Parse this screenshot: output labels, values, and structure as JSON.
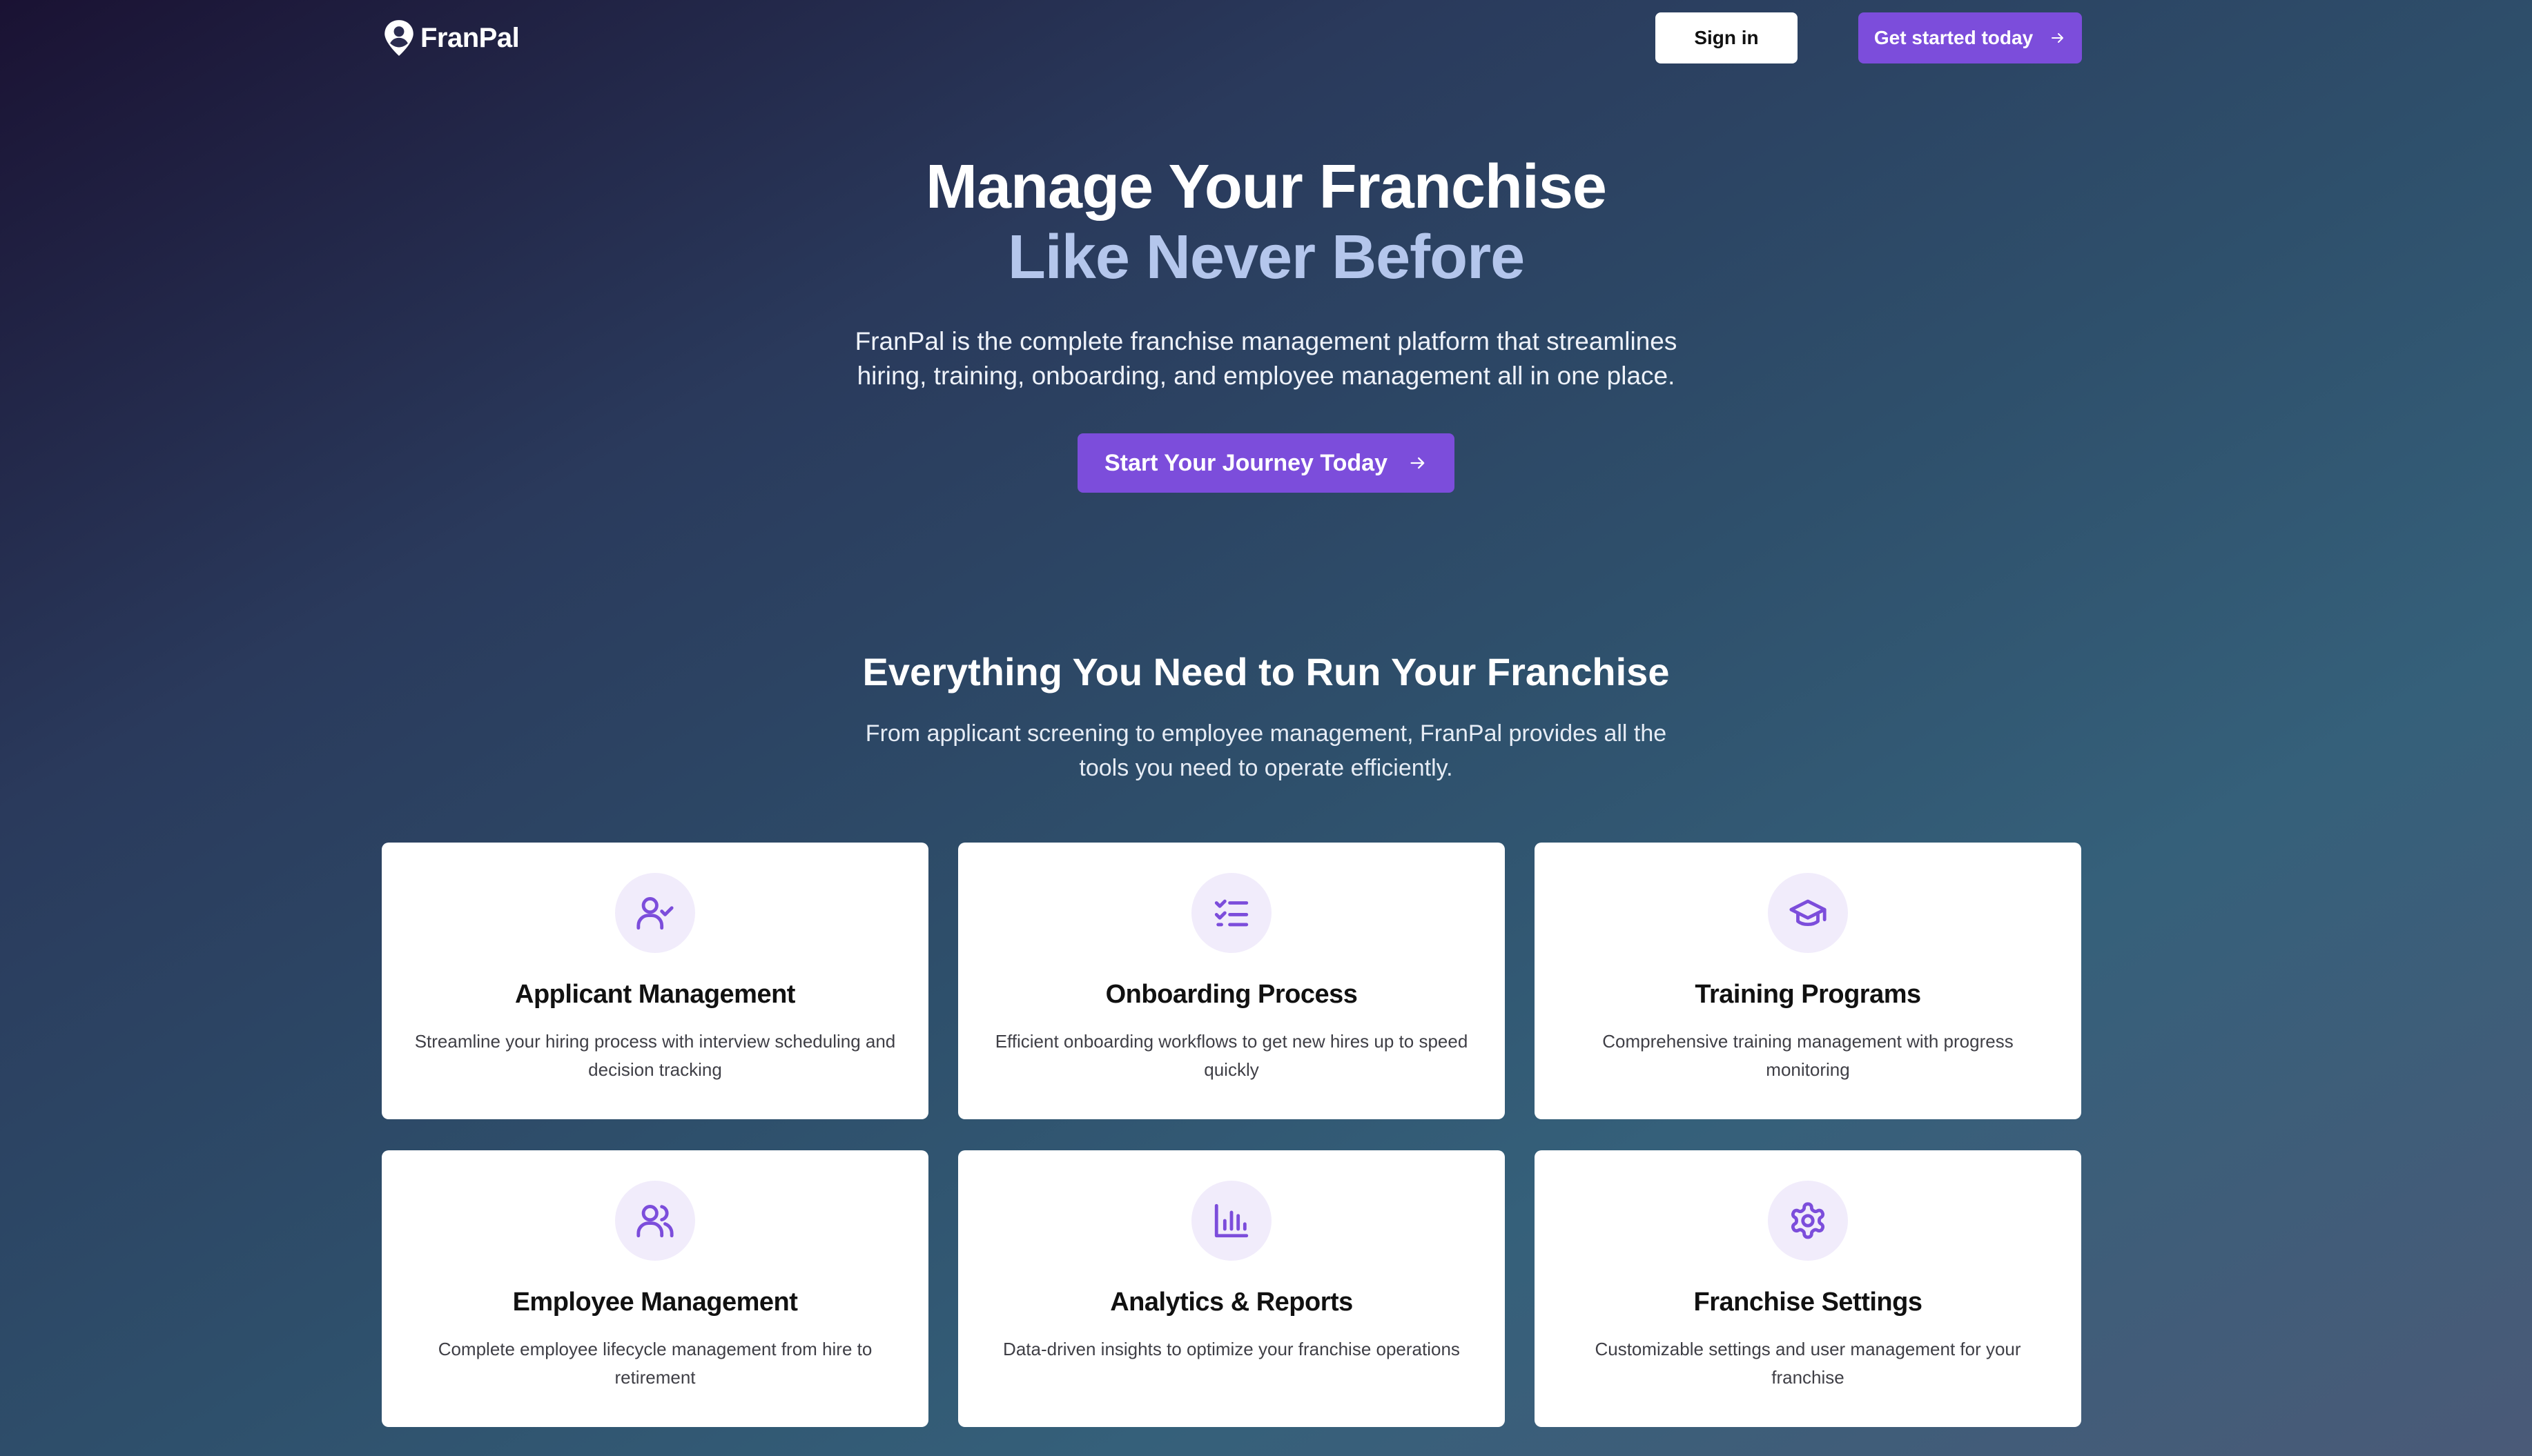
{
  "nav": {
    "brand": "FranPal",
    "signin_label": "Sign in",
    "get_started_label": "Get started today"
  },
  "hero": {
    "title_line1": "Manage Your Franchise",
    "title_line2": "Like Never Before",
    "description": "FranPal is the complete franchise management platform that streamlines hiring, training, onboarding, and employee management all in one place.",
    "cta_label": "Start Your Journey Today"
  },
  "features": {
    "heading": "Everything You Need to Run Your Franchise",
    "subheading": "From applicant screening to employee management, FranPal provides all the tools you need to operate efficiently.",
    "cards": [
      {
        "icon": "user-check-icon",
        "title": "Applicant Management",
        "description": "Streamline your hiring process with interview scheduling and decision tracking"
      },
      {
        "icon": "list-checks-icon",
        "title": "Onboarding Process",
        "description": "Efficient onboarding workflows to get new hires up to speed quickly"
      },
      {
        "icon": "graduation-cap-icon",
        "title": "Training Programs",
        "description": "Comprehensive training management with progress monitoring"
      },
      {
        "icon": "users-icon",
        "title": "Employee Management",
        "description": "Complete employee lifecycle management from hire to retirement"
      },
      {
        "icon": "bar-chart-icon",
        "title": "Analytics & Reports",
        "description": "Data-driven insights to optimize your franchise operations"
      },
      {
        "icon": "settings-gear-icon",
        "title": "Franchise Settings",
        "description": "Customizable settings and user management for your franchise"
      }
    ]
  },
  "colors": {
    "accent": "#7c4ddb",
    "accent_light": "#b4c6ec",
    "icon_bg": "#f1ecfb"
  }
}
